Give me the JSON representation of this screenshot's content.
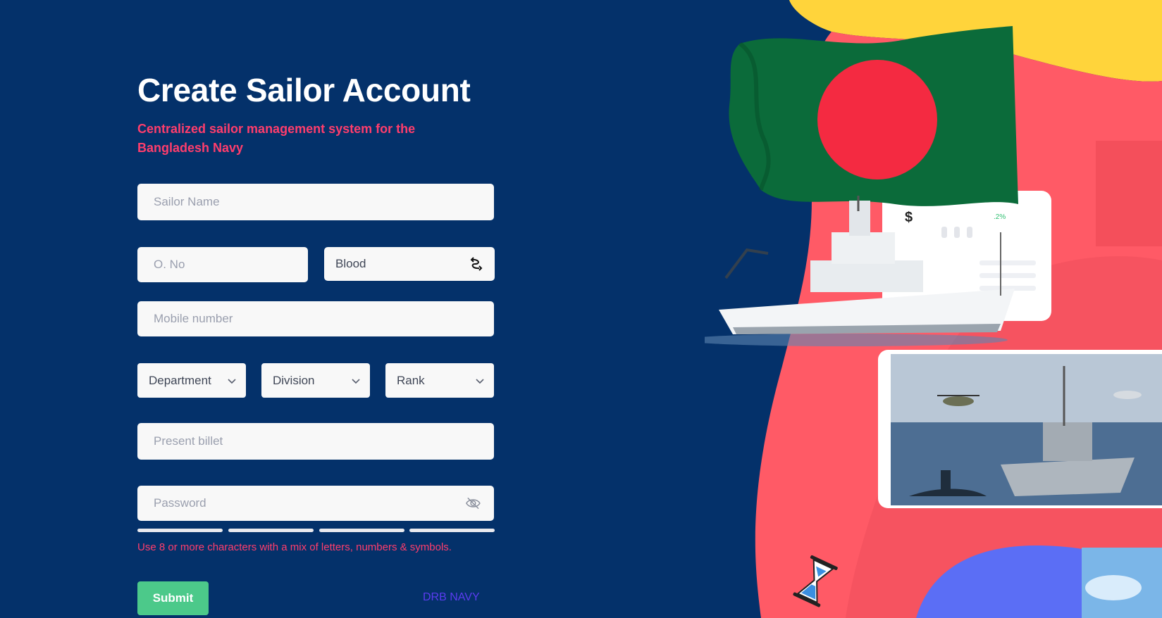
{
  "header": {
    "title": "Create Sailor Account",
    "subtitle": "Centralized sailor management system for the Bangladesh Navy"
  },
  "form": {
    "sailor_name_placeholder": "Sailor Name",
    "o_no_placeholder": "O. No",
    "blood_label": "Blood",
    "mobile_placeholder": "Mobile number",
    "department_label": "Department",
    "division_label": "Division",
    "rank_label": "Rank",
    "present_billet_placeholder": "Present billet",
    "password_placeholder": "Password",
    "password_hint": "Use 8 or more characters with a mix of letters, numbers & symbols.",
    "submit_label": "Submit",
    "brand_link": "DRB NAVY"
  },
  "illustration": {
    "card_percent": ".2%",
    "card_currency": "$"
  },
  "colors": {
    "background": "#04316a",
    "accent_pink": "#ff3d6c",
    "submit_green": "#4cc98a",
    "link_purple": "#5b3cf0",
    "blob_red": "#ff5a66",
    "blob_yellow": "#ffd43b",
    "blob_blue": "#5b6ef5",
    "flag_green": "#0b6b3a",
    "flag_red": "#f42a41"
  }
}
